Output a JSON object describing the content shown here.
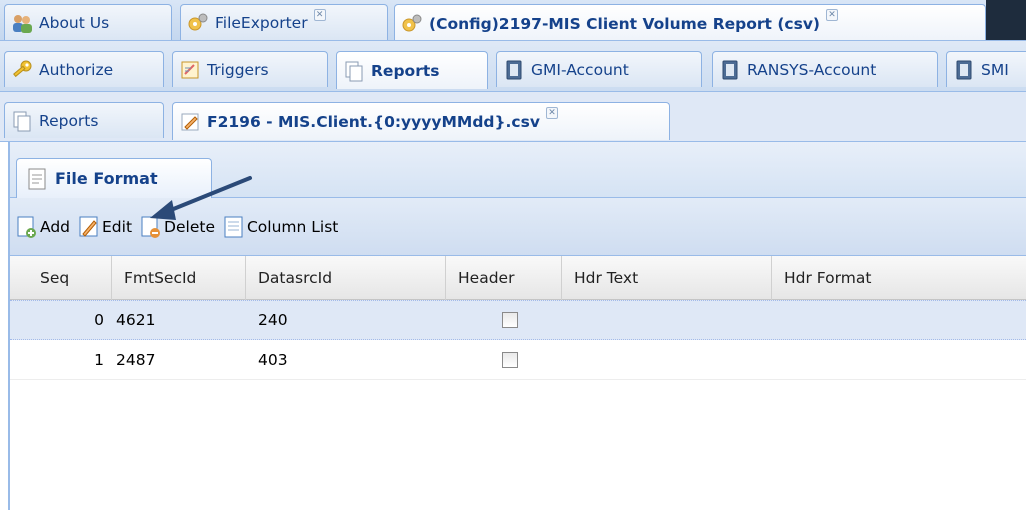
{
  "top_tabs": [
    {
      "label": "About Us",
      "icon": "people-icon"
    },
    {
      "label": "FileExporter",
      "icon": "gears-icon"
    },
    {
      "label": "(Config)2197-MIS Client Volume Report (csv)",
      "icon": "gears-icon"
    }
  ],
  "second_tabs": [
    {
      "label": "Authorize",
      "icon": "key-icon"
    },
    {
      "label": "Triggers",
      "icon": "triggers-icon"
    },
    {
      "label": "Reports",
      "icon": "reports-icon"
    },
    {
      "label": "GMI-Account",
      "icon": "document-icon"
    },
    {
      "label": "RANSYS-Account",
      "icon": "document-icon"
    },
    {
      "label": "SMI",
      "icon": "document-icon"
    }
  ],
  "third_tabs": [
    {
      "label": "Reports",
      "icon": "reports-icon"
    },
    {
      "label": "F2196 - MIS.Client.{0:yyyyMMdd}.csv",
      "icon": "pencil-icon"
    }
  ],
  "sub_tab": {
    "label": "File Format",
    "icon": "page-icon"
  },
  "toolbar": {
    "add": "Add",
    "edit": "Edit",
    "delete": "Delete",
    "column_list": "Column List"
  },
  "grid": {
    "columns": [
      "Seq",
      "FmtSecId",
      "DatasrcId",
      "Header",
      "Hdr Text",
      "Hdr Format"
    ],
    "rows": [
      {
        "seq": "0",
        "fmtsecid": "4621",
        "datasrcid": "240",
        "header": false,
        "hdr_text": "",
        "hdr_format": ""
      },
      {
        "seq": "1",
        "fmtsecid": "2487",
        "datasrcid": "403",
        "header": false,
        "hdr_text": "",
        "hdr_format": ""
      }
    ]
  },
  "colors": {
    "accent": "#15428b",
    "border": "#99bbe8",
    "arrow": "#2b4a78"
  }
}
